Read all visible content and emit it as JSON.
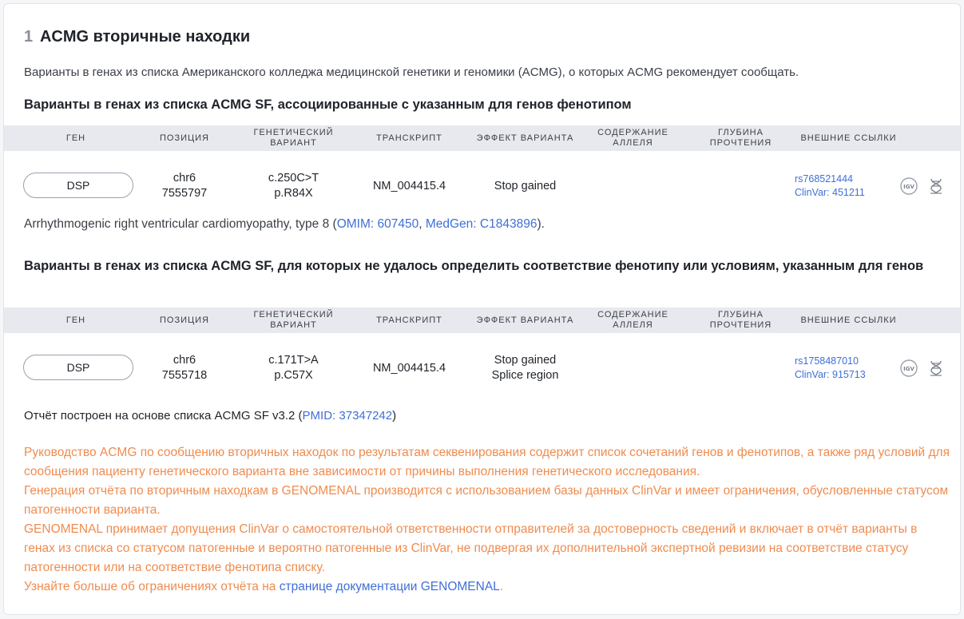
{
  "section": {
    "number": "1",
    "title": "ACMG вторичные находки",
    "intro": "Варианты в генах из списка Американского колледжа медицинской генетики и геномики (ACMG), о которых ACMG рекомендует сообщать."
  },
  "table1": {
    "heading": "Варианты в генах из списка ACMG SF, ассоциированные с указанным для генов фенотипом",
    "columns": [
      "ГЕН",
      "ПОЗИЦИЯ",
      "ГЕНЕТИЧЕСКИЙ ВАРИАНТ",
      "ТРАНСКРИПТ",
      "ЭФФЕКТ ВАРИАНТА",
      "СОДЕРЖАНИЕ АЛЛЕЛЯ",
      "ГЛУБИНА ПРОЧТЕНИЯ",
      "ВНЕШНИЕ ССЫЛКИ"
    ],
    "row": {
      "gene": "DSP",
      "position_chr": "chr6",
      "position_pos": "7555797",
      "variant_c": "c.250C>T",
      "variant_p": "p.R84X",
      "transcript": "NM_004415.4",
      "effect1": "Stop gained",
      "effect2": "",
      "rs": "rs768521444",
      "clinvar": "ClinVar: 451211"
    },
    "phenotype": {
      "text": "Arrhythmogenic right ventricular cardiomyopathy, type 8 (",
      "omim": "OMIM: 607450",
      "sep": ", ",
      "medgen": "MedGen: C1843896",
      "end": ")."
    }
  },
  "table2": {
    "heading": "Варианты в генах из списка ACMG SF, для которых не удалось определить соответствие фенотипу или условиям, указанным для генов",
    "columns": [
      "ГЕН",
      "ПОЗИЦИЯ",
      "ГЕНЕТИЧЕСКИЙ ВАРИАНТ",
      "ТРАНСКРИПТ",
      "ЭФФЕКТ ВАРИАНТА",
      "СОДЕРЖАНИЕ АЛЛЕЛЯ",
      "ГЛУБИНА ПРОЧТЕНИЯ",
      "ВНЕШНИЕ ССЫЛКИ"
    ],
    "row": {
      "gene": "DSP",
      "position_chr": "chr6",
      "position_pos": "7555718",
      "variant_c": "c.171T>A",
      "variant_p": "p.C57X",
      "transcript": "NM_004415.4",
      "effect1": "Stop gained",
      "effect2": "Splice region",
      "rs": "rs1758487010",
      "clinvar": "ClinVar: 915713"
    }
  },
  "report": {
    "built_text": "Отчёт построен на основе списка ACMG SF v3.2 (",
    "pmid": "PMID: 37347242",
    "built_end": ")"
  },
  "notes": {
    "p1": "Руководство ACMG по сообщению вторичных находок по результатам секвенирования содержит список сочетаний генов и фенотипов, а также ряд условий для сообщения пациенту генетического варианта вне зависимости от причины выполнения генетического исследования.",
    "p2": "Генерация отчёта по вторичным находкам в GENOMENAL производится с использованием базы данных ClinVar и имеет ограничения, обусловленные статусом патогенности варианта.",
    "p3": "GENOMENAL принимает допущения ClinVar о самостоятельной ответственности отправителей за достоверность сведений и включает в отчёт варианты в генах из списка со статусом патогенные и вероятно патогенные из ClinVar, не подвергая их дополнительной экспертной ревизии на соответствие статусу патогенности или на соответствие фенотипа списку.",
    "p4_text": "Узнайте больше об ограничениях отчёта на ",
    "p4_link": "странице документации GENOMENAL",
    "p4_end": "."
  },
  "icons": {
    "igv": "IGV",
    "dna": "dna-icon"
  },
  "colors": {
    "link": "#3f6fd8",
    "note": "#ef8c4f",
    "header_bg": "#e8e9ee"
  }
}
